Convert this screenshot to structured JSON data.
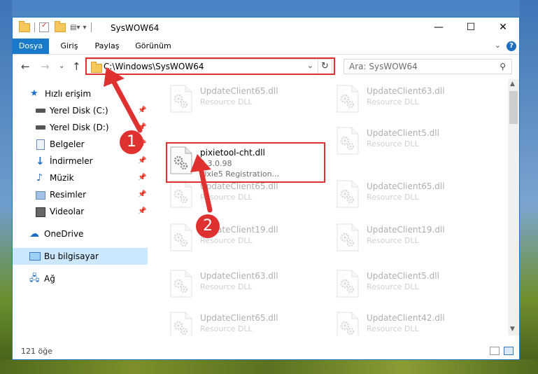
{
  "window": {
    "title": "SysWOW64"
  },
  "titlebar": {
    "minimize": "—",
    "maximize": "☐",
    "close": "✕"
  },
  "ribbon": {
    "tabs": [
      "Dosya",
      "Giriş",
      "Paylaş",
      "Görünüm"
    ],
    "help": "?",
    "expand": "⌄"
  },
  "nav": {
    "back": "←",
    "forward": "→",
    "recent": "⌄",
    "up": "↑",
    "address": "C:\\Windows\\SysWOW64",
    "refresh": "↻",
    "search_placeholder": "Ara: SysWOW64"
  },
  "sidebar": {
    "items": [
      {
        "label": "Hızlı erişim",
        "icon": "star-icon",
        "pinned": false
      },
      {
        "label": "Yerel Disk (C:)",
        "icon": "drive-icon",
        "pinned": true
      },
      {
        "label": "Yerel Disk (D:)",
        "icon": "drive-icon",
        "pinned": true
      },
      {
        "label": "Belgeler",
        "icon": "documents-icon",
        "pinned": true
      },
      {
        "label": "İndirmeler",
        "icon": "download-icon",
        "pinned": true
      },
      {
        "label": "Müzik",
        "icon": "music-icon",
        "pinned": true
      },
      {
        "label": "Resimler",
        "icon": "pictures-icon",
        "pinned": true
      },
      {
        "label": "Videolar",
        "icon": "videos-icon",
        "pinned": true
      },
      {
        "label": "OneDrive",
        "icon": "cloud-icon",
        "pinned": false
      },
      {
        "label": "Bu bilgisayar",
        "icon": "computer-icon",
        "pinned": false,
        "selected": true
      },
      {
        "label": "Ağ",
        "icon": "network-icon",
        "pinned": false
      }
    ]
  },
  "files": [
    {
      "name": "UpdateClient65.dll",
      "type": "Resource DLL"
    },
    {
      "name": "UpdateClient63.dll",
      "type": "Resource DLL"
    },
    {
      "name": "pixietool-cht.dll",
      "version": "5.3.0.98",
      "type": "Pixie5 Registration...",
      "highlighted": true
    },
    {
      "name": "UpdateClient5.dll",
      "type": "Resource DLL"
    },
    {
      "name": "UpdateClient65.dll",
      "type": "Resource DLL"
    },
    {
      "name": "UpdateClient65.dll",
      "type": "Resource DLL"
    },
    {
      "name": "UpdateClient19.dll",
      "type": "Resource DLL"
    },
    {
      "name": "UpdateClient19.dll",
      "type": "Resource DLL"
    },
    {
      "name": "UpdateClient63.dll",
      "type": "Resource DLL"
    },
    {
      "name": "UpdateClient5.dll",
      "type": "Resource DLL"
    },
    {
      "name": "UpdateClient65.dll",
      "type": "Resource DLL"
    },
    {
      "name": "UpdateClient42.dll",
      "type": "Resource DLL"
    }
  ],
  "status": {
    "count": "121 öğe"
  },
  "callouts": [
    "1",
    "2"
  ],
  "colors": {
    "accent": "#1979ca",
    "highlight": "#e03131",
    "selected": "#cce8ff"
  }
}
